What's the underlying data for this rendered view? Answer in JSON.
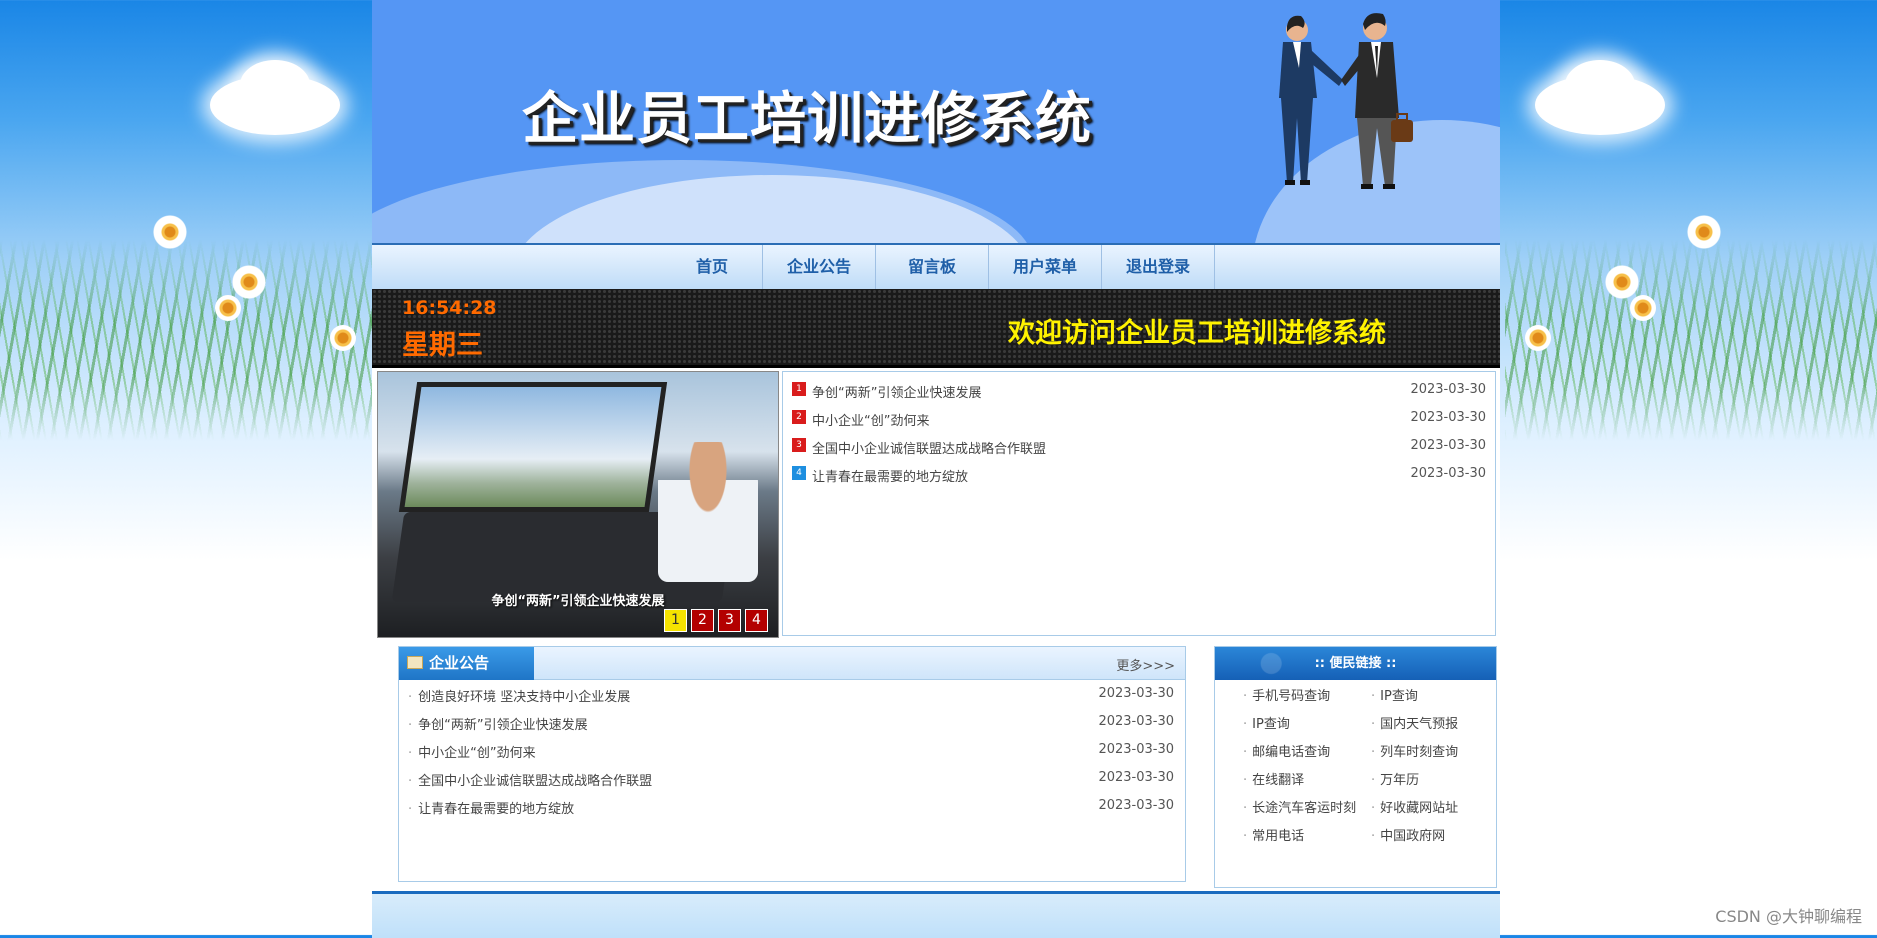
{
  "header": {
    "title": "企业员工培训进修系统"
  },
  "nav": {
    "items": [
      "首页",
      "企业公告",
      "留言板",
      "用户菜单",
      "退出登录"
    ]
  },
  "led": {
    "time": "16:54:28",
    "weekday": "星期三",
    "welcome": "欢迎访问企业员工培训进修系统"
  },
  "slider": {
    "caption": "争创“两新”引领企业快速发展",
    "pages": [
      "1",
      "2",
      "3",
      "4"
    ],
    "active_page": 1
  },
  "news": [
    {
      "num": "1",
      "title": "争创“两新”引领企业快速发展",
      "date": "2023-03-30"
    },
    {
      "num": "2",
      "title": "中小企业“创”劲何来",
      "date": "2023-03-30"
    },
    {
      "num": "3",
      "title": "全国中小企业诚信联盟达成战略合作联盟",
      "date": "2023-03-30"
    },
    {
      "num": "4",
      "title": "让青春在最需要的地方绽放",
      "date": "2023-03-30"
    }
  ],
  "notice": {
    "title": "企业公告",
    "more": "更多>>>",
    "items": [
      {
        "title": "创造良好环境 坚决支持中小企业发展",
        "date": "2023-03-30"
      },
      {
        "title": "争创“两新”引领企业快速发展",
        "date": "2023-03-30"
      },
      {
        "title": "中小企业“创”劲何来",
        "date": "2023-03-30"
      },
      {
        "title": "全国中小企业诚信联盟达成战略合作联盟",
        "date": "2023-03-30"
      },
      {
        "title": "让青春在最需要的地方绽放",
        "date": "2023-03-30"
      }
    ]
  },
  "links": {
    "title": ":: 便民链接 ::",
    "items": [
      "手机号码查询",
      "IP查询",
      "IP查询",
      "国内天气预报",
      "邮编电话查询",
      "列车时刻查询",
      "在线翻译",
      "万年历",
      "长途汽车客运时刻",
      "好收藏网站址",
      "常用电话",
      "中国政府网"
    ]
  },
  "watermark": "CSDN @大钟聊编程",
  "colors": {
    "banner": "#5596f4",
    "nav_text": "#1f5fa8",
    "led_time": "#ff6a00",
    "led_welcome": "#fff200",
    "active_dot": "#f5e200",
    "dot": "#b30000"
  }
}
